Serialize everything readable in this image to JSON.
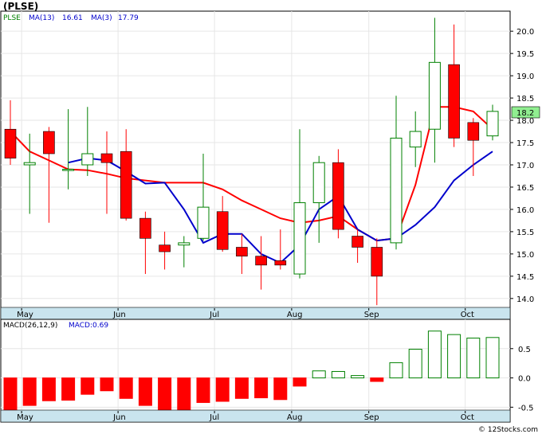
{
  "ticker": "(PLSE)",
  "legend": {
    "symbol": "PLSE",
    "ma13_label": "MA(13)",
    "ma13_value": "16.61",
    "ma3_label": "MA(3)",
    "ma3_value": "17.79"
  },
  "macd_legend": {
    "label": "MACD(26,12,9)",
    "value_label": "MACD:0.69"
  },
  "last_price_label": "18.2",
  "footer": "© 12Stocks.com",
  "colors": {
    "up": "#008000",
    "down": "#ff0000",
    "ma13": "#0000cc",
    "ma3": "#ff0000",
    "axis_band": "#c9e4ee",
    "grid": "#e6e6e6",
    "price_box": "#90ee90"
  },
  "chart_data": [
    {
      "type": "candlestick",
      "title": "(PLSE)",
      "ylim": [
        13.8,
        20.45
      ],
      "y_ticks": [
        "14.0",
        "14.5",
        "15.0",
        "15.5",
        "16.0",
        "16.5",
        "17.0",
        "17.5",
        "18.0",
        "18.5",
        "19.0",
        "19.5",
        "20.0"
      ],
      "x_month_labels": [
        {
          "label": "May",
          "bar": 1
        },
        {
          "label": "Jun",
          "bar": 6
        },
        {
          "label": "Jul",
          "bar": 11
        },
        {
          "label": "Aug",
          "bar": 15
        },
        {
          "label": "Sep",
          "bar": 19
        },
        {
          "label": "Oct",
          "bar": 24
        }
      ],
      "candles": [
        {
          "o": 17.8,
          "h": 18.45,
          "l": 17.0,
          "c": 17.15
        },
        {
          "o": 17.0,
          "h": 17.7,
          "l": 15.9,
          "c": 17.05
        },
        {
          "o": 17.75,
          "h": 17.85,
          "l": 15.7,
          "c": 17.25
        },
        {
          "o": 16.9,
          "h": 18.25,
          "l": 16.45,
          "c": 16.9
        },
        {
          "o": 17.0,
          "h": 18.3,
          "l": 16.75,
          "c": 17.25
        },
        {
          "o": 17.25,
          "h": 17.75,
          "l": 15.9,
          "c": 17.05
        },
        {
          "o": 17.3,
          "h": 17.8,
          "l": 15.75,
          "c": 15.8
        },
        {
          "o": 15.8,
          "h": 15.95,
          "l": 14.55,
          "c": 15.35
        },
        {
          "o": 15.2,
          "h": 15.5,
          "l": 14.65,
          "c": 15.05
        },
        {
          "o": 15.2,
          "h": 15.4,
          "l": 14.7,
          "c": 15.25
        },
        {
          "o": 15.35,
          "h": 17.25,
          "l": 15.3,
          "c": 16.05
        },
        {
          "o": 15.95,
          "h": 16.3,
          "l": 15.05,
          "c": 15.1
        },
        {
          "o": 15.15,
          "h": 15.45,
          "l": 14.55,
          "c": 14.95
        },
        {
          "o": 14.95,
          "h": 15.4,
          "l": 14.2,
          "c": 14.75
        },
        {
          "o": 14.85,
          "h": 15.55,
          "l": 14.65,
          "c": 14.75
        },
        {
          "o": 14.55,
          "h": 17.8,
          "l": 14.45,
          "c": 16.15
        },
        {
          "o": 16.15,
          "h": 17.2,
          "l": 15.25,
          "c": 17.05
        },
        {
          "o": 17.05,
          "h": 17.35,
          "l": 15.35,
          "c": 15.55
        },
        {
          "o": 15.4,
          "h": 15.55,
          "l": 14.8,
          "c": 15.15
        },
        {
          "o": 15.15,
          "h": 15.35,
          "l": 13.85,
          "c": 14.5
        },
        {
          "o": 15.25,
          "h": 18.55,
          "l": 15.1,
          "c": 17.6
        },
        {
          "o": 17.4,
          "h": 18.2,
          "l": 16.95,
          "c": 17.75
        },
        {
          "o": 17.8,
          "h": 20.3,
          "l": 17.05,
          "c": 19.3
        },
        {
          "o": 19.25,
          "h": 20.15,
          "l": 17.4,
          "c": 17.6
        },
        {
          "o": 17.95,
          "h": 18.05,
          "l": 16.75,
          "c": 17.55
        },
        {
          "o": 17.65,
          "h": 18.35,
          "l": 17.55,
          "c": 18.2
        }
      ],
      "ma3": [
        17.75,
        17.3,
        17.1,
        16.9,
        16.88,
        16.8,
        16.7,
        16.65,
        16.6,
        16.6,
        16.6,
        16.45,
        16.2,
        16.0,
        15.8,
        15.7,
        15.75,
        15.85,
        15.55,
        15.3,
        15.35,
        16.55,
        18.3,
        18.3,
        18.2,
        17.8
      ],
      "ma13": [
        null,
        null,
        null,
        17.05,
        17.15,
        17.1,
        16.85,
        16.58,
        16.6,
        16.0,
        15.25,
        15.45,
        15.45,
        15.0,
        14.8,
        15.2,
        16.0,
        16.3,
        15.55,
        15.3,
        15.35,
        15.65,
        16.05,
        16.65,
        17.0,
        17.3
      ]
    },
    {
      "type": "bar",
      "title": "MACD(26,12,9)",
      "ylim": [
        -0.55,
        1.0
      ],
      "y_ticks": [
        "-0.5",
        "0.0",
        "0.5"
      ],
      "values": [
        -0.56,
        -0.47,
        -0.39,
        -0.38,
        -0.28,
        -0.22,
        -0.35,
        -0.47,
        -0.62,
        -0.65,
        -0.42,
        -0.4,
        -0.35,
        -0.34,
        -0.37,
        -0.14,
        0.12,
        0.11,
        0.04,
        -0.06,
        0.26,
        0.49,
        0.8,
        0.74,
        0.68,
        0.69
      ]
    }
  ]
}
